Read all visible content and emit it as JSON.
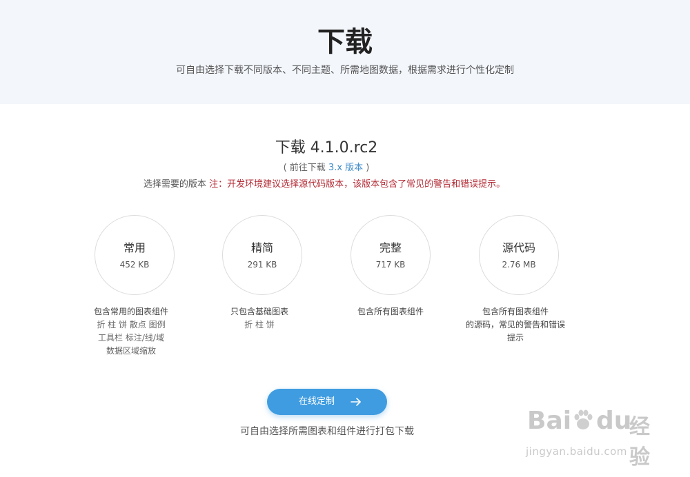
{
  "hero": {
    "title": "下载",
    "subtitle": "可自由选择下载不同版本、不同主题、所需地图数据，根据需求进行个性化定制"
  },
  "version": {
    "title": "下载 4.1.0.rc2",
    "link_prefix": "( 前往下载 ",
    "link_text": "3.x 版本",
    "link_suffix": " )",
    "choose_label": "选择需要的版本 ",
    "choose_note": "注：开发环境建议选择源代码版本，该版本包含了常见的警告和错误提示。"
  },
  "packages": [
    {
      "name": "常用",
      "size": "452 KB",
      "desc": "包含常用的图表组件",
      "details": [
        "折 柱 饼 散点 图例",
        "工具栏 标注/线/域",
        "数据区域缩放"
      ]
    },
    {
      "name": "精简",
      "size": "291 KB",
      "desc": "只包含基础图表",
      "details": [
        "折 柱 饼"
      ]
    },
    {
      "name": "完整",
      "size": "717 KB",
      "desc": "包含所有图表组件",
      "details": []
    },
    {
      "name": "源代码",
      "size": "2.76 MB",
      "desc": "包含所有图表组件",
      "details": [
        "的源码，常见的警告和错误",
        "提示"
      ]
    }
  ],
  "custom": {
    "button_label": "在线定制",
    "subtitle": "可自由选择所需图表和组件进行打包下载"
  },
  "watermark": {
    "brand": "Bai",
    "brand2": "du",
    "brand_cn": "经验",
    "url": "jingyan.baidu.com"
  },
  "colors": {
    "hero_bg": "#f3f6fb",
    "link": "#3f8bc8",
    "note": "#b32b35",
    "button": "#3f9ce0"
  }
}
